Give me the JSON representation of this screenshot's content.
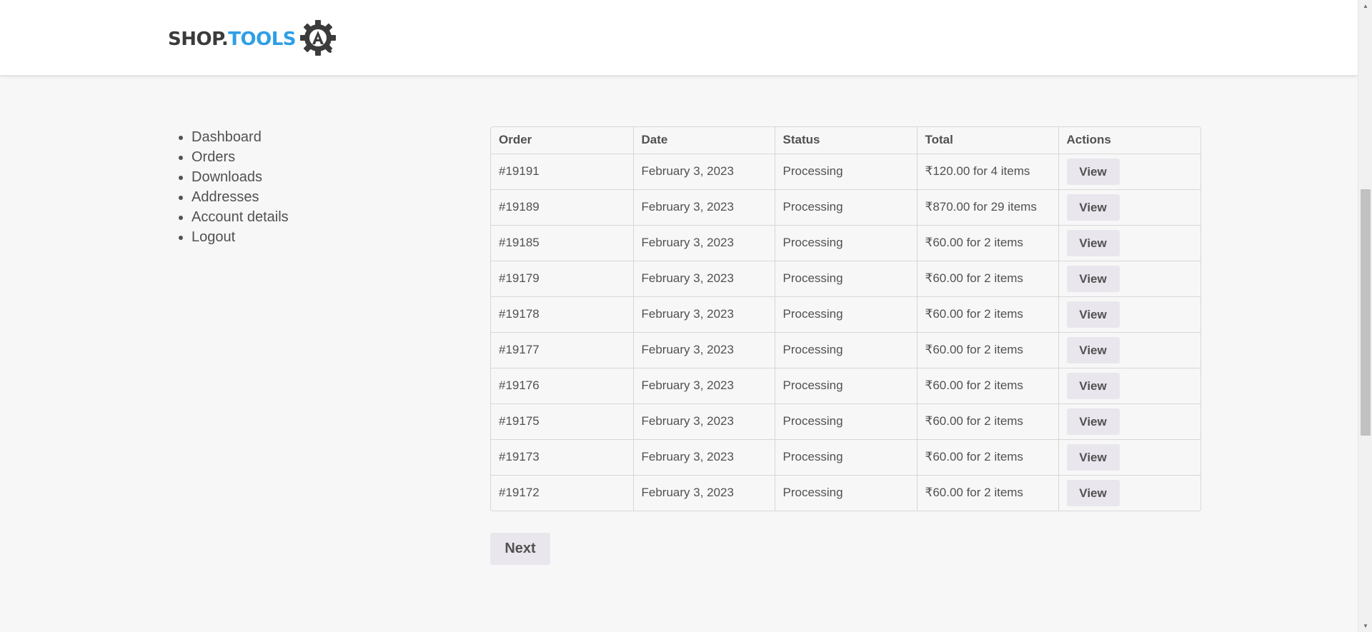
{
  "header": {
    "logo": {
      "shop": "SHOP.",
      "tools": "TOOLS",
      "gear_letter": "A"
    }
  },
  "nav": {
    "items": [
      {
        "label": "Dashboard"
      },
      {
        "label": "Orders"
      },
      {
        "label": "Downloads"
      },
      {
        "label": "Addresses"
      },
      {
        "label": "Account details"
      },
      {
        "label": "Logout"
      }
    ]
  },
  "orders": {
    "columns": [
      "Order",
      "Date",
      "Status",
      "Total",
      "Actions"
    ],
    "rows": [
      {
        "order": "#19191",
        "date": "February 3, 2023",
        "status": "Processing",
        "total": "₹120.00 for 4 items",
        "action": "View"
      },
      {
        "order": "#19189",
        "date": "February 3, 2023",
        "status": "Processing",
        "total": "₹870.00 for 29 items",
        "action": "View"
      },
      {
        "order": "#19185",
        "date": "February 3, 2023",
        "status": "Processing",
        "total": "₹60.00 for 2 items",
        "action": "View"
      },
      {
        "order": "#19179",
        "date": "February 3, 2023",
        "status": "Processing",
        "total": "₹60.00 for 2 items",
        "action": "View"
      },
      {
        "order": "#19178",
        "date": "February 3, 2023",
        "status": "Processing",
        "total": "₹60.00 for 2 items",
        "action": "View"
      },
      {
        "order": "#19177",
        "date": "February 3, 2023",
        "status": "Processing",
        "total": "₹60.00 for 2 items",
        "action": "View"
      },
      {
        "order": "#19176",
        "date": "February 3, 2023",
        "status": "Processing",
        "total": "₹60.00 for 2 items",
        "action": "View"
      },
      {
        "order": "#19175",
        "date": "February 3, 2023",
        "status": "Processing",
        "total": "₹60.00 for 2 items",
        "action": "View"
      },
      {
        "order": "#19173",
        "date": "February 3, 2023",
        "status": "Processing",
        "total": "₹60.00 for 2 items",
        "action": "View"
      },
      {
        "order": "#19172",
        "date": "February 3, 2023",
        "status": "Processing",
        "total": "₹60.00 for 2 items",
        "action": "View"
      }
    ]
  },
  "pagination": {
    "next_label": "Next"
  },
  "colors": {
    "brand_dark": "#3b3b3b",
    "brand_blue": "#2e9fe6",
    "background": "#f7f7f7",
    "button_bg": "#e9e6ed",
    "text": "#515151"
  }
}
